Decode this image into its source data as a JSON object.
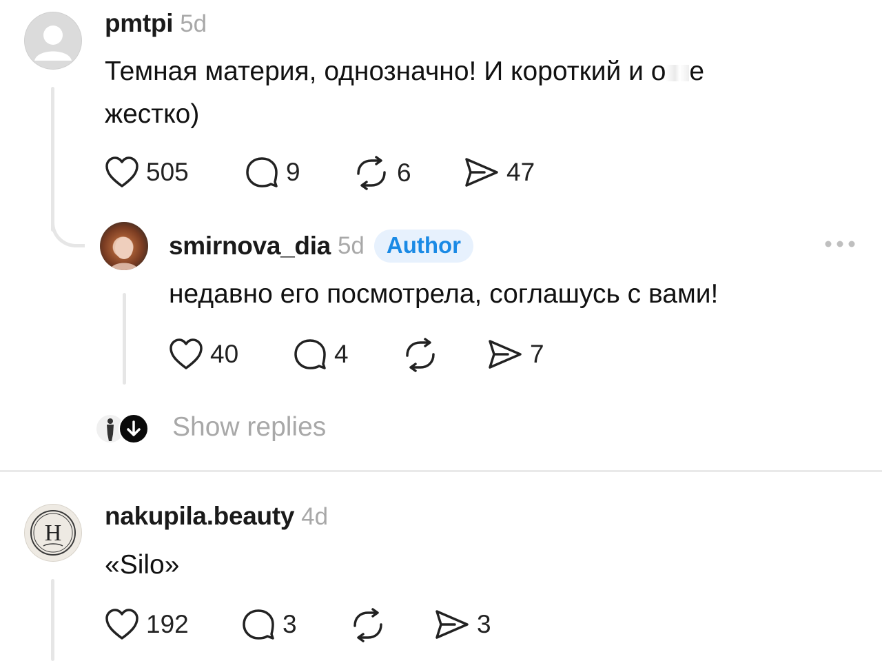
{
  "comments": [
    {
      "username": "pmtpi",
      "time": "5d",
      "text_line1": "Темная материя, однозначно! И короткий и о",
      "text_line1_end": "е",
      "text_line2": "жестко)",
      "likes": "505",
      "replies": "9",
      "reposts": "6",
      "shares": "47"
    },
    {
      "username": "smirnova_dia",
      "time": "5d",
      "badge": "Author",
      "text": "недавно его посмотрела, соглашусь с вами!",
      "likes": "40",
      "replies": "4",
      "reposts": "",
      "shares": "7"
    },
    {
      "username": "nakupila.beauty",
      "time": "4d",
      "avatar_letter": "H",
      "text": "«Silo»",
      "likes": "192",
      "replies": "3",
      "reposts": "",
      "shares": "3"
    }
  ],
  "show_replies": "Show replies",
  "colors": {
    "accent": "#1a8ae5",
    "badge_bg": "#e7f1fd",
    "muted": "#a8a8a8",
    "thread_line": "#e6e6e6"
  },
  "icons": [
    "heart-icon",
    "comment-icon",
    "repost-icon",
    "share-icon",
    "more-icon",
    "arrow-down-icon"
  ]
}
